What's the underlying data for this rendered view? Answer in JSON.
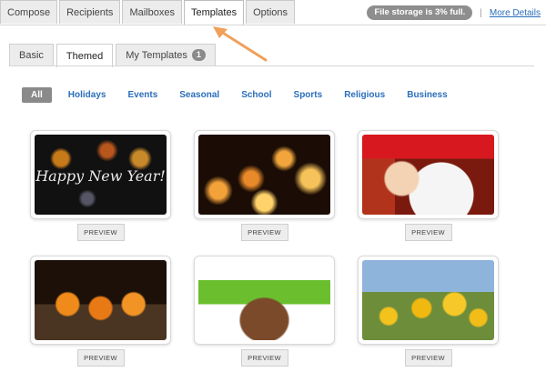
{
  "top_tabs": [
    "Compose",
    "Recipients",
    "Mailboxes",
    "Templates",
    "Options"
  ],
  "storage": {
    "badge": "File storage is 3% full.",
    "separator": "|",
    "more_link": "More Details"
  },
  "sub_tabs": {
    "basic": "Basic",
    "themed": "Themed",
    "my_templates": "My Templates",
    "my_templates_count": "1"
  },
  "categories": [
    "All",
    "Holidays",
    "Events",
    "Seasonal",
    "School",
    "Sports",
    "Religious",
    "Business"
  ],
  "templates": [
    {
      "image": "happy-new-year-fireworks",
      "overlay_text": "Happy New Year!",
      "preview_label": "PREVIEW"
    },
    {
      "image": "candles",
      "overlay_text": "",
      "preview_label": "PREVIEW"
    },
    {
      "image": "santa-claus",
      "overlay_text": "",
      "preview_label": "PREVIEW"
    },
    {
      "image": "jack-o-lanterns",
      "overlay_text": "",
      "preview_label": "PREVIEW"
    },
    {
      "image": "easter-grass-basket",
      "overlay_text": "",
      "preview_label": "PREVIEW"
    },
    {
      "image": "sunflower-field",
      "overlay_text": "",
      "preview_label": "PREVIEW"
    }
  ],
  "colors": {
    "link": "#2a6ebb",
    "badge": "#8a8a8a",
    "arrow": "#f0a05a"
  }
}
